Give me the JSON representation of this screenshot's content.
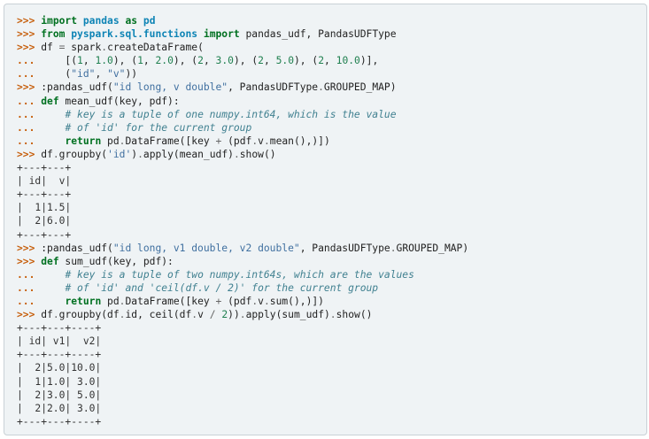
{
  "code_lines": [
    [
      {
        "t": "gp",
        "v": ">>> "
      },
      {
        "t": "k",
        "v": "import"
      },
      {
        "t": "",
        "v": " "
      },
      {
        "t": "nn",
        "v": "pandas"
      },
      {
        "t": "",
        "v": " "
      },
      {
        "t": "k",
        "v": "as"
      },
      {
        "t": "",
        "v": " "
      },
      {
        "t": "nn",
        "v": "pd"
      }
    ],
    [
      {
        "t": "gp",
        "v": ">>> "
      },
      {
        "t": "k",
        "v": "from"
      },
      {
        "t": "",
        "v": " "
      },
      {
        "t": "nn",
        "v": "pyspark.sql.functions"
      },
      {
        "t": "",
        "v": " "
      },
      {
        "t": "k",
        "v": "import"
      },
      {
        "t": "",
        "v": " pandas_udf, PandasUDFType"
      }
    ],
    [
      {
        "t": "gp",
        "v": ">>> "
      },
      {
        "t": "",
        "v": "df "
      },
      {
        "t": "o",
        "v": "="
      },
      {
        "t": "",
        "v": " spark"
      },
      {
        "t": "o",
        "v": "."
      },
      {
        "t": "",
        "v": "createDataFrame("
      }
    ],
    [
      {
        "t": "gp",
        "v": "... "
      },
      {
        "t": "",
        "v": "    [("
      },
      {
        "t": "m",
        "v": "1"
      },
      {
        "t": "",
        "v": ", "
      },
      {
        "t": "m",
        "v": "1.0"
      },
      {
        "t": "",
        "v": "), ("
      },
      {
        "t": "m",
        "v": "1"
      },
      {
        "t": "",
        "v": ", "
      },
      {
        "t": "m",
        "v": "2.0"
      },
      {
        "t": "",
        "v": "), ("
      },
      {
        "t": "m",
        "v": "2"
      },
      {
        "t": "",
        "v": ", "
      },
      {
        "t": "m",
        "v": "3.0"
      },
      {
        "t": "",
        "v": "), ("
      },
      {
        "t": "m",
        "v": "2"
      },
      {
        "t": "",
        "v": ", "
      },
      {
        "t": "m",
        "v": "5.0"
      },
      {
        "t": "",
        "v": "), ("
      },
      {
        "t": "m",
        "v": "2"
      },
      {
        "t": "",
        "v": ", "
      },
      {
        "t": "m",
        "v": "10.0"
      },
      {
        "t": "",
        "v": ")],"
      }
    ],
    [
      {
        "t": "gp",
        "v": "... "
      },
      {
        "t": "",
        "v": "    ("
      },
      {
        "t": "s",
        "v": "\"id\""
      },
      {
        "t": "",
        "v": ", "
      },
      {
        "t": "s",
        "v": "\"v\""
      },
      {
        "t": "",
        "v": "))"
      }
    ],
    [
      {
        "t": "gp",
        "v": ">>> "
      },
      {
        "t": "",
        "v": ":pandas_udf("
      },
      {
        "t": "s",
        "v": "\"id long, v double\""
      },
      {
        "t": "",
        "v": ", PandasUDFType"
      },
      {
        "t": "o",
        "v": "."
      },
      {
        "t": "",
        "v": "GROUPED_MAP)"
      }
    ],
    [
      {
        "t": "gp",
        "v": "... "
      },
      {
        "t": "k",
        "v": "def"
      },
      {
        "t": "",
        "v": " mean_udf(key, pdf):"
      }
    ],
    [
      {
        "t": "gp",
        "v": "... "
      },
      {
        "t": "",
        "v": "    "
      },
      {
        "t": "c",
        "v": "# key is a tuple of one numpy.int64, which is the value"
      }
    ],
    [
      {
        "t": "gp",
        "v": "... "
      },
      {
        "t": "",
        "v": "    "
      },
      {
        "t": "c",
        "v": "# of 'id' for the current group"
      }
    ],
    [
      {
        "t": "gp",
        "v": "... "
      },
      {
        "t": "",
        "v": "    "
      },
      {
        "t": "k",
        "v": "return"
      },
      {
        "t": "",
        "v": " pd"
      },
      {
        "t": "o",
        "v": "."
      },
      {
        "t": "",
        "v": "DataFrame([key "
      },
      {
        "t": "o",
        "v": "+"
      },
      {
        "t": "",
        "v": " (pdf"
      },
      {
        "t": "o",
        "v": "."
      },
      {
        "t": "",
        "v": "v"
      },
      {
        "t": "o",
        "v": "."
      },
      {
        "t": "",
        "v": "mean(),)])"
      }
    ],
    [
      {
        "t": "gp",
        "v": ">>> "
      },
      {
        "t": "",
        "v": "df"
      },
      {
        "t": "o",
        "v": "."
      },
      {
        "t": "",
        "v": "groupby("
      },
      {
        "t": "s",
        "v": "'id'"
      },
      {
        "t": "",
        "v": ")"
      },
      {
        "t": "o",
        "v": "."
      },
      {
        "t": "",
        "v": "apply(mean_udf)"
      },
      {
        "t": "o",
        "v": "."
      },
      {
        "t": "",
        "v": "show()"
      }
    ],
    [
      {
        "t": "go",
        "v": "+---+---+"
      }
    ],
    [
      {
        "t": "go",
        "v": "| id|  v|"
      }
    ],
    [
      {
        "t": "go",
        "v": "+---+---+"
      }
    ],
    [
      {
        "t": "go",
        "v": "|  1|1.5|"
      }
    ],
    [
      {
        "t": "go",
        "v": "|  2|6.0|"
      }
    ],
    [
      {
        "t": "go",
        "v": "+---+---+"
      }
    ],
    [
      {
        "t": "gp",
        "v": ">>> "
      },
      {
        "t": "",
        "v": ":pandas_udf("
      },
      {
        "t": "s",
        "v": "\"id long, v1 double, v2 double\""
      },
      {
        "t": "",
        "v": ", PandasUDFType"
      },
      {
        "t": "o",
        "v": "."
      },
      {
        "t": "",
        "v": "GROUPED_MAP)"
      }
    ],
    [
      {
        "t": "gp",
        "v": ">>> "
      },
      {
        "t": "k",
        "v": "def"
      },
      {
        "t": "",
        "v": " sum_udf(key, pdf):"
      }
    ],
    [
      {
        "t": "gp",
        "v": "... "
      },
      {
        "t": "",
        "v": "    "
      },
      {
        "t": "c",
        "v": "# key is a tuple of two numpy.int64s, which are the values"
      }
    ],
    [
      {
        "t": "gp",
        "v": "... "
      },
      {
        "t": "",
        "v": "    "
      },
      {
        "t": "c",
        "v": "# of 'id' and 'ceil(df.v / 2)' for the current group"
      }
    ],
    [
      {
        "t": "gp",
        "v": "... "
      },
      {
        "t": "",
        "v": "    "
      },
      {
        "t": "k",
        "v": "return"
      },
      {
        "t": "",
        "v": " pd"
      },
      {
        "t": "o",
        "v": "."
      },
      {
        "t": "",
        "v": "DataFrame([key "
      },
      {
        "t": "o",
        "v": "+"
      },
      {
        "t": "",
        "v": " (pdf"
      },
      {
        "t": "o",
        "v": "."
      },
      {
        "t": "",
        "v": "v"
      },
      {
        "t": "o",
        "v": "."
      },
      {
        "t": "",
        "v": "sum(),)])"
      }
    ],
    [
      {
        "t": "gp",
        "v": ">>> "
      },
      {
        "t": "",
        "v": "df"
      },
      {
        "t": "o",
        "v": "."
      },
      {
        "t": "",
        "v": "groupby(df"
      },
      {
        "t": "o",
        "v": "."
      },
      {
        "t": "",
        "v": "id, ceil(df"
      },
      {
        "t": "o",
        "v": "."
      },
      {
        "t": "",
        "v": "v "
      },
      {
        "t": "o",
        "v": "/"
      },
      {
        "t": "",
        "v": " "
      },
      {
        "t": "m",
        "v": "2"
      },
      {
        "t": "",
        "v": "))"
      },
      {
        "t": "o",
        "v": "."
      },
      {
        "t": "",
        "v": "apply(sum_udf)"
      },
      {
        "t": "o",
        "v": "."
      },
      {
        "t": "",
        "v": "show()"
      }
    ],
    [
      {
        "t": "go",
        "v": "+---+---+----+"
      }
    ],
    [
      {
        "t": "go",
        "v": "| id| v1|  v2|"
      }
    ],
    [
      {
        "t": "go",
        "v": "+---+---+----+"
      }
    ],
    [
      {
        "t": "go",
        "v": "|  2|5.0|10.0|"
      }
    ],
    [
      {
        "t": "go",
        "v": "|  1|1.0| 3.0|"
      }
    ],
    [
      {
        "t": "go",
        "v": "|  2|3.0| 5.0|"
      }
    ],
    [
      {
        "t": "go",
        "v": "|  2|2.0| 3.0|"
      }
    ],
    [
      {
        "t": "go",
        "v": "+---+---+----+"
      }
    ]
  ]
}
